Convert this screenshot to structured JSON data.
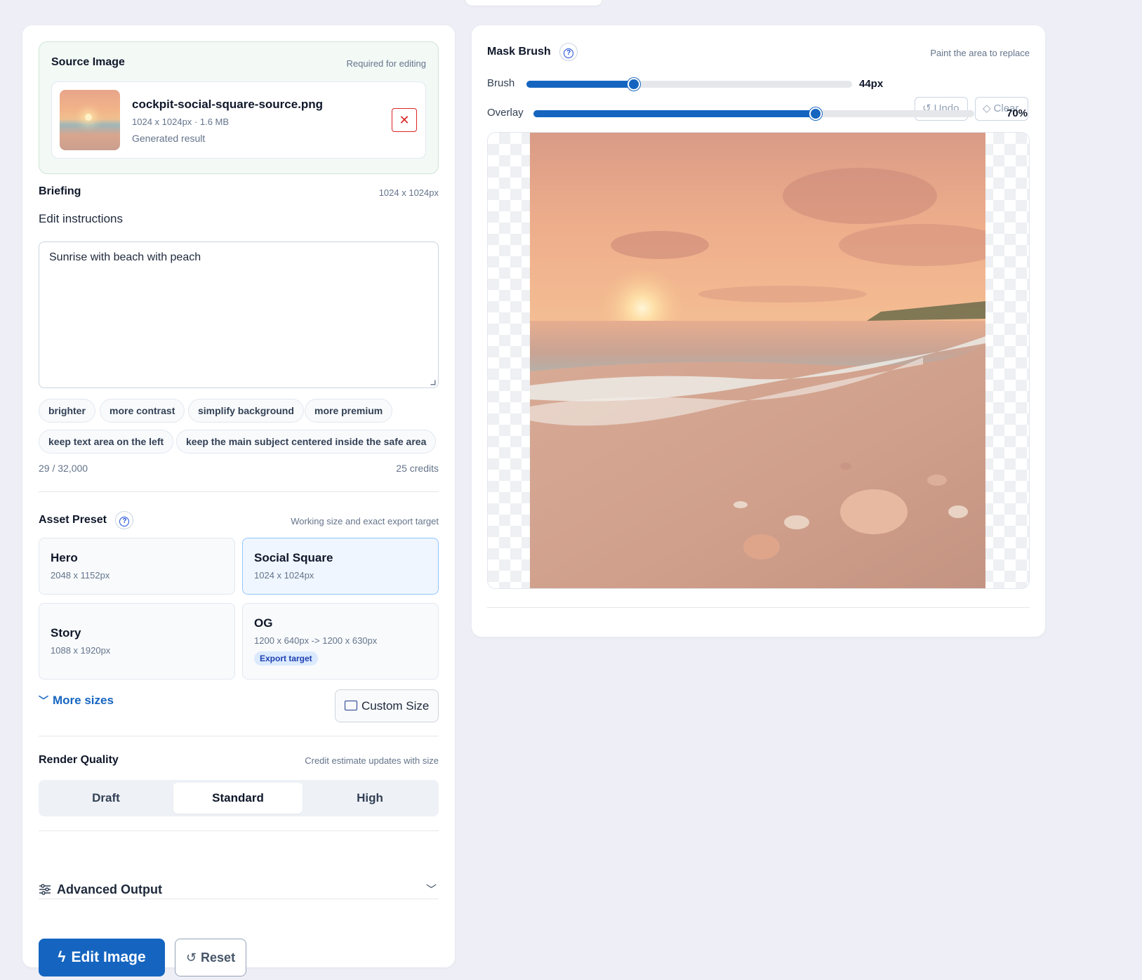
{
  "source": {
    "title": "Source Image",
    "hint": "Required for editing",
    "file_name": "cockpit-social-square-source.png",
    "file_meta": "1024 x 1024px · 1.6 MB",
    "file_sub": "Generated result"
  },
  "briefing": {
    "title": "Briefing",
    "size": "1024 x 1024px",
    "instructions_label": "Edit instructions",
    "instructions_value": "Sunrise with beach with peach",
    "chips": [
      "brighter",
      "more contrast",
      "simplify background",
      "more premium",
      "keep text area on the left",
      "keep the main subject centered inside the safe area"
    ],
    "char_count": "29 / 32,000",
    "credits": "25 credits"
  },
  "asset_preset": {
    "title": "Asset Preset",
    "hint": "Working size and exact export target",
    "presets": [
      {
        "name": "Hero",
        "size": "2048 x 1152px"
      },
      {
        "name": "Social Square",
        "size": "1024 x 1024px"
      },
      {
        "name": "Story",
        "size": "1088 x 1920px"
      },
      {
        "name": "OG",
        "size": "1200 x 640px -> 1200 x 630px",
        "badge": "Export target"
      }
    ],
    "selected": "Social Square",
    "more_sizes": "More sizes",
    "custom_size": "Custom Size"
  },
  "render_quality": {
    "title": "Render Quality",
    "hint": "Credit estimate updates with size",
    "options": [
      "Draft",
      "Standard",
      "High"
    ],
    "selected": "Standard"
  },
  "advanced_output": {
    "label": "Advanced Output"
  },
  "actions": {
    "edit": "Edit Image",
    "reset": "Reset"
  },
  "mask_brush": {
    "title": "Mask Brush",
    "hint": "Paint the area to replace",
    "brush_label": "Brush",
    "brush_value": "44px",
    "brush_fraction": 0.33,
    "overlay_label": "Overlay",
    "overlay_value": "70%",
    "overlay_fraction": 0.64,
    "undo": "Undo",
    "clear": "Clear"
  },
  "colors": {
    "accent": "#1565c0",
    "danger": "#dc2626",
    "source_bg": "#f3f9f5"
  },
  "icons": [
    "help-circle-icon",
    "close-icon",
    "chevron-down-icon",
    "crop-icon",
    "sliders-icon",
    "bolt-icon",
    "rotate-ccw-icon",
    "eraser-icon"
  ]
}
